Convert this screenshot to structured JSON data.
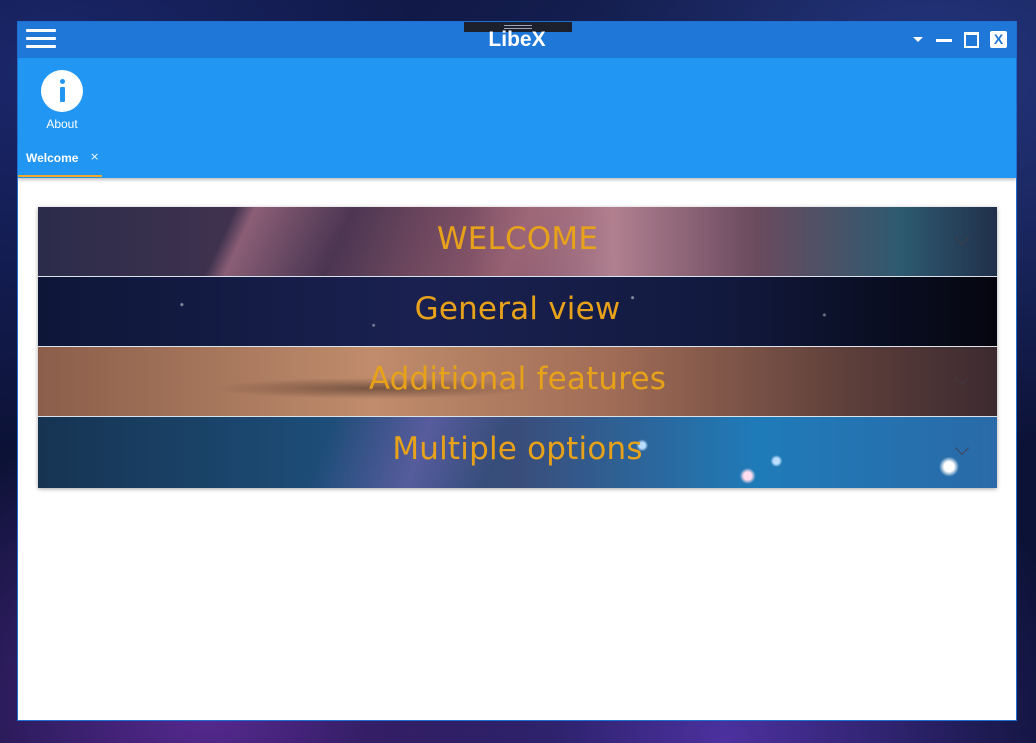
{
  "window": {
    "title": "LibeX"
  },
  "toolbar": {
    "about_label": "About",
    "about_icon": "info-icon"
  },
  "tabs": [
    {
      "label": "Welcome",
      "close": "×",
      "active": true
    }
  ],
  "accordion": {
    "panels": [
      {
        "title": "WELCOME"
      },
      {
        "title": "General view"
      },
      {
        "title": "Additional features"
      },
      {
        "title": "Multiple options"
      }
    ]
  },
  "colors": {
    "titlebar": "#1f78d8",
    "toolbar": "#2196f3",
    "accent": "#f5a623",
    "panel_text": "#e8a21a"
  },
  "icons": {
    "menu": "hamburger-icon",
    "dropdown": "caret-down-icon",
    "minimize": "minimize-icon",
    "maximize": "maximize-icon",
    "close": "close-icon",
    "expand": "chevron-down-icon"
  }
}
